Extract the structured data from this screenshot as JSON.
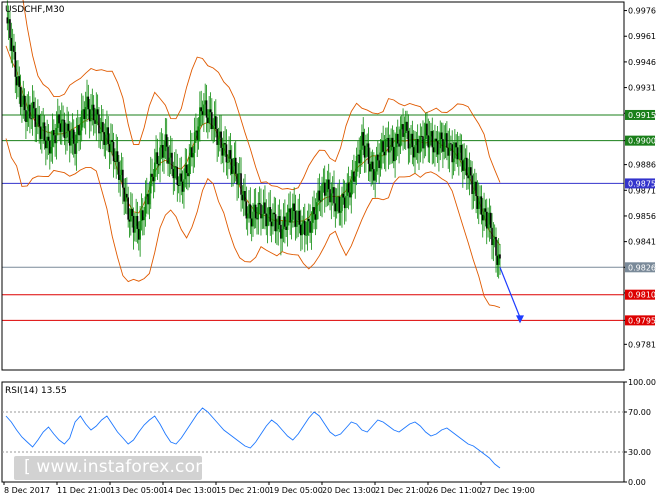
{
  "chart_data": [
    {
      "type": "candlestick",
      "title": "USDCHF,M30",
      "ylim": [
        0.9766,
        0.9981
      ],
      "y_ticks": [
        "0.9976",
        "0.9961",
        "0.9946",
        "0.9931",
        "0.9916",
        "0.9900",
        "0.9886",
        "0.9871",
        "0.9856",
        "0.9841",
        "0.9826",
        "0.9811",
        "0.9795",
        "0.9781"
      ],
      "x_ticks": [
        "8 Dec 2017",
        "11 Dec 21:00",
        "13 Dec 05:00",
        "14 Dec 13:00",
        "15 Dec 21:00",
        "19 Dec 05:00",
        "20 Dec 13:00",
        "21 Dec 21:00",
        "26 Dec 11:00",
        "27 Dec 19:00"
      ],
      "close_series": [
        0.9972,
        0.9958,
        0.9936,
        0.9922,
        0.9915,
        0.9918,
        0.9909,
        0.9905,
        0.9896,
        0.9902,
        0.9912,
        0.9906,
        0.9903,
        0.9898,
        0.991,
        0.9921,
        0.9916,
        0.9914,
        0.9905,
        0.9902,
        0.9895,
        0.9886,
        0.9874,
        0.9858,
        0.9852,
        0.9848,
        0.986,
        0.9871,
        0.9886,
        0.9892,
        0.9898,
        0.9887,
        0.988,
        0.9874,
        0.9882,
        0.9894,
        0.9906,
        0.9921,
        0.9915,
        0.9911,
        0.9901,
        0.9895,
        0.9889,
        0.9884,
        0.9876,
        0.9862,
        0.9855,
        0.9858,
        0.986,
        0.9856,
        0.9855,
        0.9851,
        0.9848,
        0.9855,
        0.9858,
        0.9853,
        0.9848,
        0.985,
        0.9857,
        0.9868,
        0.9873,
        0.987,
        0.9864,
        0.9862,
        0.9868,
        0.9874,
        0.9886,
        0.9899,
        0.9893,
        0.988,
        0.9888,
        0.9896,
        0.9898,
        0.9894,
        0.9902,
        0.9908,
        0.9899,
        0.9895,
        0.9898,
        0.9904,
        0.99,
        0.9896,
        0.99,
        0.9898,
        0.9892,
        0.9895,
        0.9888,
        0.9882,
        0.9872,
        0.9864,
        0.9856,
        0.9852,
        0.9838,
        0.9827
      ],
      "horizontal_levels": [
        {
          "label": "0.9915",
          "value": 0.9915,
          "color": "#1a7f1a"
        },
        {
          "label": "0.9900",
          "value": 0.99,
          "color": "#1a7f1a"
        },
        {
          "label": "0.9875",
          "value": 0.9875,
          "color": "#3333cc"
        },
        {
          "label": "0.9826",
          "value": 0.9826,
          "color": "#7a8a99"
        },
        {
          "label": "0.9810",
          "value": 0.981,
          "color": "#dd0000"
        },
        {
          "label": "0.9795",
          "value": 0.9795,
          "color": "#dd0000"
        }
      ],
      "forecast_arrow": {
        "from_value": 0.9826,
        "to_value": 0.9795,
        "color": "#1e3cff"
      },
      "candle_color": "#0a8a0a",
      "envelope_color": "#e05a00",
      "axis_box_color": "#000000"
    },
    {
      "type": "line",
      "title": "RSI(14) 13.55",
      "ylim": [
        0,
        100
      ],
      "y_ticks": [
        "100.00",
        "70.00",
        "30.00",
        "0.00"
      ],
      "levels": [
        70,
        30
      ],
      "values": [
        66,
        60,
        52,
        45,
        40,
        35,
        42,
        50,
        55,
        48,
        42,
        38,
        44,
        60,
        66,
        58,
        52,
        56,
        62,
        66,
        58,
        50,
        44,
        38,
        42,
        50,
        57,
        62,
        66,
        58,
        48,
        40,
        38,
        44,
        52,
        60,
        68,
        74,
        70,
        64,
        58,
        52,
        48,
        44,
        40,
        36,
        34,
        40,
        48,
        56,
        62,
        58,
        52,
        46,
        42,
        48,
        56,
        64,
        70,
        66,
        58,
        50,
        46,
        48,
        54,
        60,
        58,
        52,
        50,
        56,
        62,
        60,
        56,
        52,
        50,
        54,
        58,
        60,
        56,
        50,
        46,
        48,
        52,
        54,
        50,
        46,
        42,
        38,
        36,
        32,
        28,
        24,
        18,
        14
      ],
      "line_color": "#1e78ff"
    }
  ],
  "watermark": "[ www.instaforex.com ]"
}
